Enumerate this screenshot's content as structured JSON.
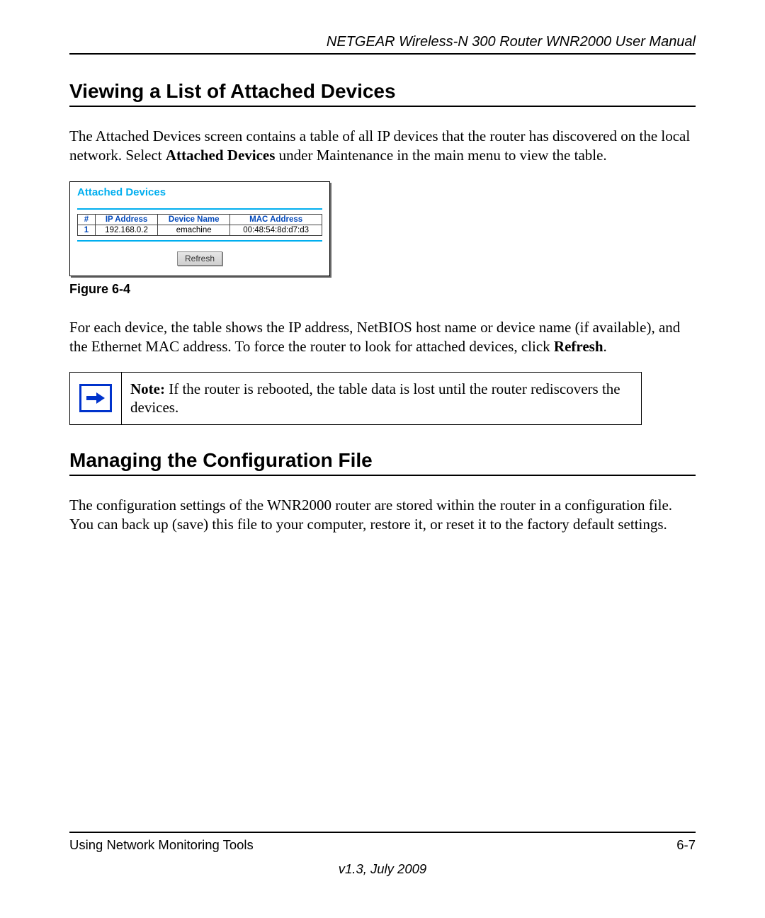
{
  "header": {
    "running_head": "NETGEAR Wireless-N 300 Router WNR2000 User Manual"
  },
  "section1": {
    "title": "Viewing a List of Attached Devices",
    "p1a": "The Attached Devices screen contains a table of all IP devices that the router has discovered on the local network. Select ",
    "p1b_bold": "Attached Devices",
    "p1c": " under Maintenance in the main menu to view the table."
  },
  "panel": {
    "title": "Attached Devices",
    "headers": {
      "num": "#",
      "ip": "IP Address",
      "name": "Device Name",
      "mac": "MAC Address"
    },
    "rows": [
      {
        "num": "1",
        "ip": "192.168.0.2",
        "name": "emachine",
        "mac": "00:48:54:8d:d7:d3"
      }
    ],
    "refresh_label": "Refresh"
  },
  "figure_caption": "Figure 6-4",
  "after_panel": {
    "p_a": "For each device, the table shows the IP address, NetBIOS host name or device name (if available), and the Ethernet MAC address. To force the router to look for attached devices, click ",
    "p_b_bold": "Refresh",
    "p_c": "."
  },
  "note": {
    "label": "Note:",
    "text": " If the router is rebooted, the table data is lost until the router rediscovers the devices."
  },
  "section2": {
    "title": "Managing the Configuration File",
    "p1": "The configuration settings of the WNR2000 router are stored within the router in a configuration file. You can back up (save) this file to your computer, restore it, or reset it to the factory default settings."
  },
  "footer": {
    "left": "Using Network Monitoring Tools",
    "right": "6-7",
    "version": "v1.3, July 2009"
  }
}
